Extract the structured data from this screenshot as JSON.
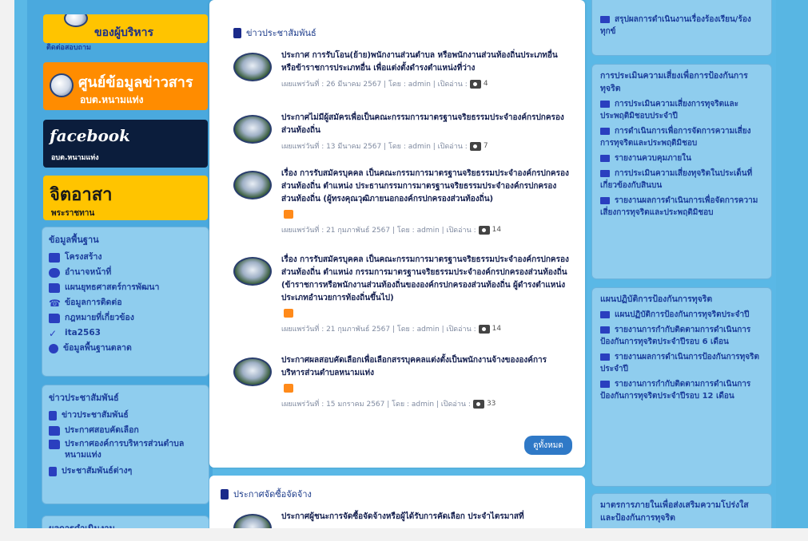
{
  "left": {
    "banner_top": {
      "line1": "ของผู้บริหาร",
      "line2": "ติดต่อสอบถาม"
    },
    "info_center": {
      "line1": "ศูนย์ข้อมูลข่าวสาร",
      "line2": "อบต.หนามแท่ง"
    },
    "facebook": {
      "line1": "facebook",
      "line2": "อบต.หนามแท่ง"
    },
    "volunteer": {
      "line1": "จิตอาสา",
      "line2": "พระราชทาน"
    },
    "basic_info": {
      "title": "ข้อมูลพื้นฐาน",
      "items": [
        "โครงสร้าง",
        "อำนาจหน้าที่",
        "แผนยุทธศาสตร์การพัฒนา",
        "ข้อมูลการติดต่อ",
        "กฎหมายที่เกี่ยวข้อง",
        "ita2563",
        "ข้อมูลพื้นฐานตลาด"
      ]
    },
    "pr": {
      "title": "ข่าวประชาสัมพันธ์",
      "items": [
        "ข่าวประชาสัมพันธ์",
        "ประกาศสอบคัดเลือก",
        "ประกาศองค์การบริหารส่วนตำบลหนามแท่ง",
        "ประชาสัมพันธ์ต่างๆ"
      ]
    },
    "ops": {
      "title": "ผลการดำเนินงาน"
    }
  },
  "main": {
    "section_title": "ข่าวประชาสัมพันธ์",
    "news": [
      {
        "title": "ประกาศ การรับโอน(ย้าย)พนักงานส่วนตำบล หรือพนักงานส่วนท้องถิ่นประเภทอื่น หรือข้าราชการประเภทอื่น เพื่อแต่งตั้งดำรงตำแหน่งที่ว่าง",
        "meta": "เผยแพร่วันที่ : 26 มีนาคม 2567 | โดย : admin | เปิดอ่าน :",
        "views": "4"
      },
      {
        "title": "ประกาศไม่มีผู้สมัครเพื่อเป็นคณะกรรมการมาตรฐานจริยธรรมประจำองค์กรปกครองส่วนท้องถิ่น",
        "meta": "เผยแพร่วันที่ : 13 มีนาคม 2567 | โดย : admin | เปิดอ่าน :",
        "views": "7"
      },
      {
        "title": "เรื่อง การรับสมัครบุคคล เป็นคณะกรรมการมาตรฐานจริยธรรมประจำองค์กรปกครองส่วนท้องถิ่น ตำแหน่ง ประธานกรรมการมาตรฐานจริยธรรมประจำองค์กรปกครองส่วนท้องถิ่น (ผู้ทรงคุณวุฒิภายนอกองค์กรปกครองส่วนท้องถิ่น)",
        "meta": "เผยแพร่วันที่ : 21 กุมภาพันธ์ 2567 | โดย : admin | เปิดอ่าน :",
        "views": "14"
      },
      {
        "title": "เรื่อง การรับสมัครบุคคล เป็นคณะกรรมการมาตรฐานจริยธรรมประจำองค์กรปกครองส่วนท้องถิ่น ตำแหน่ง กรรมการมาตรฐานจริยธรรมประจำองค์กรปกครองส่วนท้องถิ่น (ข้าราชการหรือพนักงานส่วนท้องถิ่นขององค์กรปกครองส่วนท้องถิ่น ผู้ดำรงตำแหน่งประเภทอำนวยการท้องถิ่นขึ้นไป)",
        "meta": "เผยแพร่วันที่ : 21 กุมภาพันธ์ 2567 | โดย : admin | เปิดอ่าน :",
        "views": "14"
      },
      {
        "title": "ประกาศผลสอบคัดเลือกเพื่อเลือกสรรบุคคลแต่งตั้งเป็นพนักงานจ้างขององค์การบริหารส่วนตำบลหนามแท่ง",
        "meta": "เผยแพร่วันที่ : 15 มกราคม 2567 | โดย : admin | เปิดอ่าน :",
        "views": "33"
      }
    ],
    "more_label": "ดูทั้งหมด",
    "section2_title": "ประกาศจัดซื้อจัดจ้าง",
    "section2_first": "ประกาศผู้ชนะการจัดซื้อจัดจ้างหรือผู้ได้รับการคัดเลือก ประจำไตรมาสที่"
  },
  "right": {
    "top_item": "สรุปผลการดำเนินงานเรื่องร้องเรียน/ร้องทุกข์",
    "risk": {
      "title": "การประเมินความเสี่ยงเพื่อการป้องกันการทุจริต",
      "items": [
        "การประเมินความเสี่ยงการทุจริตและประพฤติมิชอบประจำปี",
        "การดำเนินการเพื่อการจัดการความเสี่ยงการทุจริตและประพฤติมิชอบ",
        "รายงานควบคุมภายใน",
        "การประเมินความเสี่ยงทุจริตในประเด็นที่เกี่ยวข้องกับสินบน",
        "รายงานผลการดำเนินการเพื่อจัดการความเสี่ยงการทุจริตและประพฤติมิชอบ"
      ]
    },
    "plan": {
      "title": "แผนปฏิบัติการป้องกันการทุจริต",
      "items": [
        "แผนปฏิบัติการป้องกันการทุจริตประจำปี",
        "รายงานการกำกับติดตามการดำเนินการป้องกันการทุจริตประจำปีรอบ 6 เดือน",
        "รายงานผลการดำเนินการป้องกันการทุจริตประจำปี",
        "รายงานการกำกับติดตามการดำเนินการป้องกันการทุจริตประจำปีรอบ 12 เดือน"
      ]
    },
    "measures": {
      "title": "มาตรการภายในเพื่อส่งเสริมความโปร่งใสและป้องกันการทุจริต"
    }
  }
}
